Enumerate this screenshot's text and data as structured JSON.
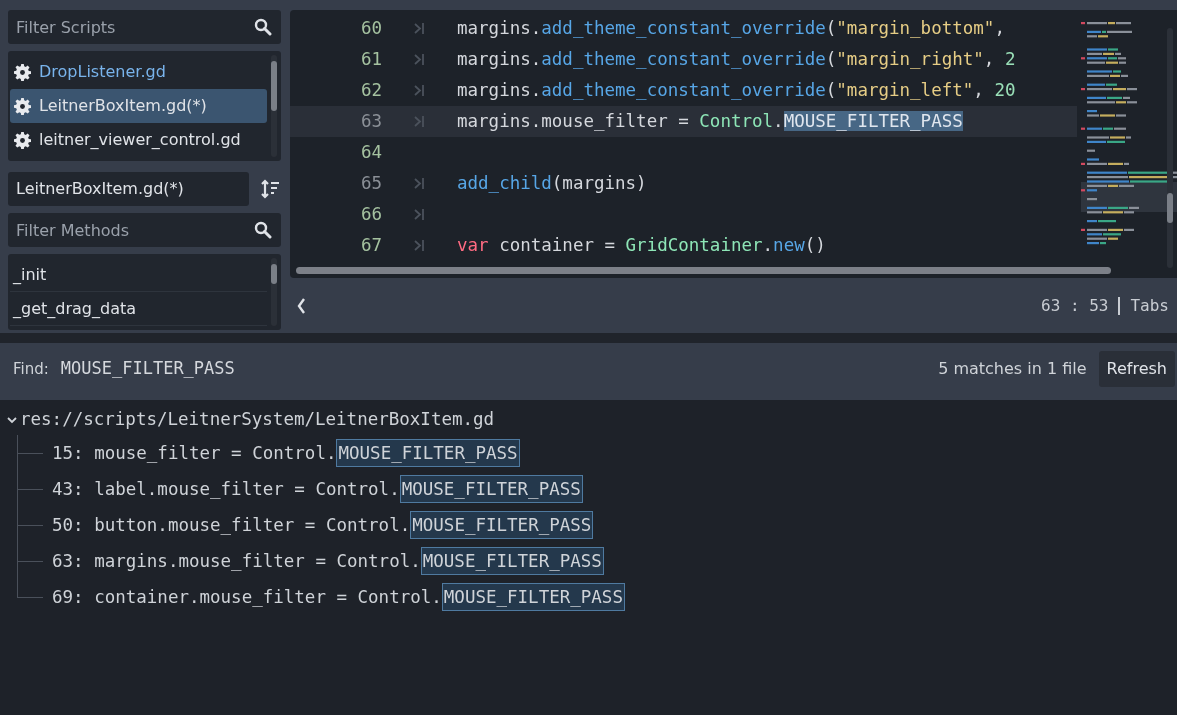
{
  "script_filter": {
    "placeholder": "Filter Scripts"
  },
  "scripts": [
    {
      "name": "DropListener.gd",
      "selected": false,
      "color": "#79b4ec"
    },
    {
      "name": "LeitnerBoxItem.gd(*)",
      "selected": true,
      "color": "#e0e3e8"
    },
    {
      "name": "leitner_viewer_control.gd",
      "selected": false,
      "color": "#e0e3e8"
    }
  ],
  "current_script": "LeitnerBoxItem.gd(*)",
  "method_filter": {
    "placeholder": "Filter Methods"
  },
  "methods": [
    "_init",
    "_get_drag_data"
  ],
  "editor": {
    "lines": [
      {
        "number": "60",
        "modified": true,
        "current": false,
        "indent_marker": true,
        "tokens": [
          {
            "text": "margins.",
            "kind": "plain"
          },
          {
            "text": "add_theme_constant_override",
            "kind": "member"
          },
          {
            "text": "(",
            "kind": "plain"
          },
          {
            "text": "\"margin_bottom\"",
            "kind": "string"
          },
          {
            "text": ",",
            "kind": "plain"
          }
        ]
      },
      {
        "number": "61",
        "modified": true,
        "current": false,
        "indent_marker": true,
        "tokens": [
          {
            "text": "margins.",
            "kind": "plain"
          },
          {
            "text": "add_theme_constant_override",
            "kind": "member"
          },
          {
            "text": "(",
            "kind": "plain"
          },
          {
            "text": "\"margin_right\"",
            "kind": "string"
          },
          {
            "text": ", ",
            "kind": "plain"
          },
          {
            "text": "2",
            "kind": "number"
          }
        ]
      },
      {
        "number": "62",
        "modified": true,
        "current": false,
        "indent_marker": true,
        "tokens": [
          {
            "text": "margins.",
            "kind": "plain"
          },
          {
            "text": "add_theme_constant_override",
            "kind": "member"
          },
          {
            "text": "(",
            "kind": "plain"
          },
          {
            "text": "\"margin_left\"",
            "kind": "string"
          },
          {
            "text": ", ",
            "kind": "plain"
          },
          {
            "text": "20",
            "kind": "number"
          }
        ]
      },
      {
        "number": "63",
        "modified": false,
        "current": true,
        "indent_marker": true,
        "tokens": [
          {
            "text": "margins.mouse_filter = ",
            "kind": "plain"
          },
          {
            "text": "Control",
            "kind": "class"
          },
          {
            "text": ".",
            "kind": "plain"
          },
          {
            "text": "MOUSE_FILTER_PASS",
            "kind": "selection"
          }
        ]
      },
      {
        "number": "64",
        "modified": true,
        "current": false,
        "indent_marker": false
      },
      {
        "number": "65",
        "modified": false,
        "current": false,
        "indent_marker": true,
        "tokens": [
          {
            "text": "add_child",
            "kind": "member"
          },
          {
            "text": "(margins)",
            "kind": "plain"
          }
        ]
      },
      {
        "number": "66",
        "modified": true,
        "current": false,
        "indent_marker": true
      },
      {
        "number": "67",
        "modified": true,
        "current": false,
        "indent_marker": true,
        "tokens": [
          {
            "text": "var",
            "kind": "keyword"
          },
          {
            "text": " container = ",
            "kind": "plain"
          },
          {
            "text": "GridContainer",
            "kind": "class"
          },
          {
            "text": ".",
            "kind": "plain"
          },
          {
            "text": "new",
            "kind": "member"
          },
          {
            "text": "()",
            "kind": "plain"
          }
        ]
      }
    ]
  },
  "status": {
    "cursor": "63 :  53",
    "indent": "Tabs"
  },
  "find": {
    "label": "Find:",
    "query": "MOUSE_FILTER_PASS",
    "summary": "5 matches in 1 file",
    "button": "Refresh"
  },
  "results": {
    "file": "res://scripts/LeitnerSystem/LeitnerBoxItem.gd",
    "expanded": true,
    "matches": [
      {
        "text": "15: mouse_filter = Control.",
        "match": "MOUSE_FILTER_PASS"
      },
      {
        "text": "43: label.mouse_filter = Control.",
        "match": "MOUSE_FILTER_PASS"
      },
      {
        "text": "50: button.mouse_filter = Control.",
        "match": "MOUSE_FILTER_PASS"
      },
      {
        "text": "63: margins.mouse_filter = Control.",
        "match": "MOUSE_FILTER_PASS"
      },
      {
        "text": "69: container.mouse_filter = Control.",
        "match": "MOUSE_FILTER_PASS"
      }
    ]
  }
}
